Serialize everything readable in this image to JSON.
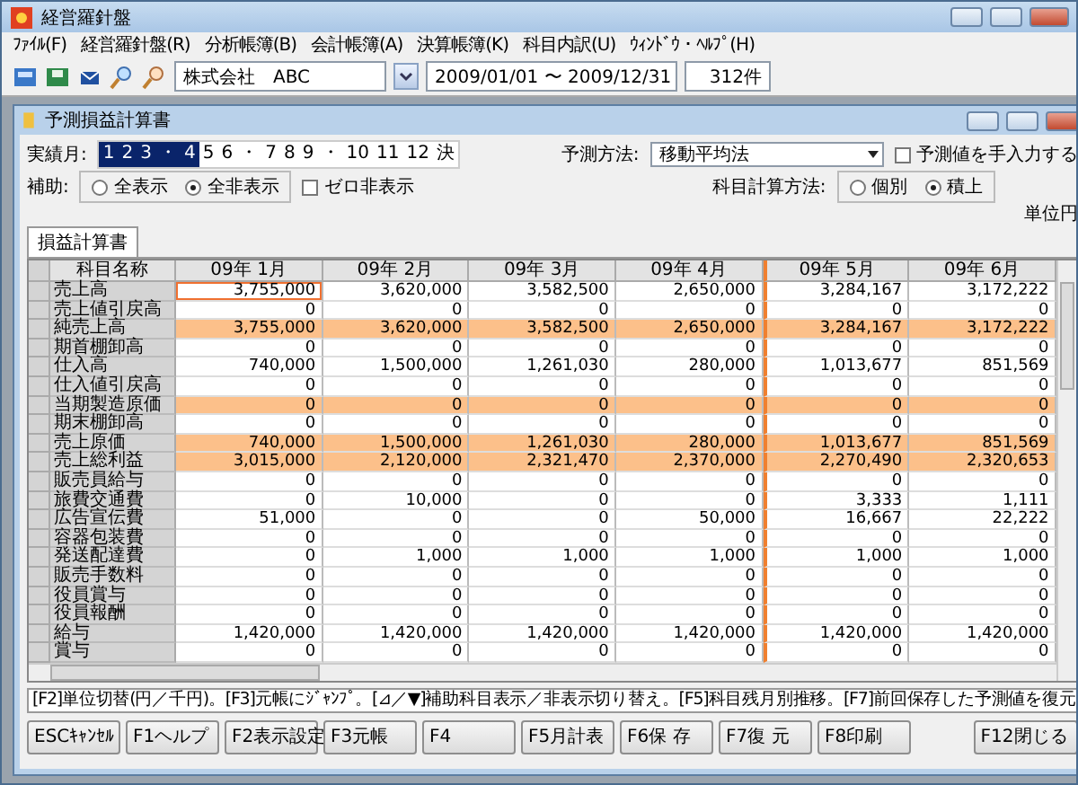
{
  "window": {
    "title": "経営羅針盤"
  },
  "menu": [
    "ﾌｧｲﾙ(F)",
    "経営羅針盤(R)",
    "分析帳簿(B)",
    "会計帳簿(A)",
    "決算帳簿(K)",
    "科目内訳(U)",
    "ｳｨﾝﾄﾞｳ・ﾍﾙﾌﾟ(H)"
  ],
  "toolbar": {
    "company": "株式会社　ABC",
    "period": "2009/01/01 〜 2009/12/31",
    "count": "312件"
  },
  "child_window": {
    "title": "予測損益計算書"
  },
  "actual_months": {
    "label": "実績月:",
    "items": [
      {
        "text": "1",
        "selected": true
      },
      {
        "text": "2",
        "selected": true
      },
      {
        "text": "3",
        "selected": true
      },
      {
        "text": "・",
        "selected": true
      },
      {
        "text": "4",
        "selected": true
      },
      {
        "text": "5",
        "selected": false
      },
      {
        "text": "6",
        "selected": false
      },
      {
        "text": "・",
        "selected": false
      },
      {
        "text": "7",
        "selected": false
      },
      {
        "text": "8",
        "selected": false
      },
      {
        "text": "9",
        "selected": false
      },
      {
        "text": "・",
        "selected": false
      },
      {
        "text": "10",
        "selected": false
      },
      {
        "text": "11",
        "selected": false
      },
      {
        "text": "12",
        "selected": false
      },
      {
        "text": "決",
        "selected": false
      }
    ]
  },
  "aux": {
    "label": "補助:",
    "options": [
      {
        "label": "全表示",
        "selected": false
      },
      {
        "label": "全非表示",
        "selected": true
      }
    ],
    "zero_hide": {
      "label": "ゼロ非表示",
      "checked": false
    }
  },
  "forecast": {
    "label": "予測方法:",
    "method": "移動平均法",
    "manual": {
      "label": "予測値を手入力する",
      "checked": false
    }
  },
  "calc": {
    "label": "科目計算方法:",
    "options": [
      {
        "label": "個別",
        "selected": false
      },
      {
        "label": "積上",
        "selected": true
      }
    ]
  },
  "unit": "単位円",
  "tabs": [
    {
      "label": "損益計算書",
      "selected": true
    }
  ],
  "table": {
    "columns": [
      {
        "label": "科目名称"
      },
      {
        "label": "09年 1月",
        "actual": true
      },
      {
        "label": "09年 2月",
        "actual": true
      },
      {
        "label": "09年 3月",
        "actual": true
      },
      {
        "label": "09年 4月",
        "actual": true
      },
      {
        "label": "09年 5月",
        "actual": false
      },
      {
        "label": "09年 6月",
        "actual": false
      }
    ],
    "rows": [
      {
        "name": "売上高",
        "highlight": false,
        "focused": true,
        "values": [
          "3,755,000",
          "3,620,000",
          "3,582,500",
          "2,650,000",
          "3,284,167",
          "3,172,222"
        ]
      },
      {
        "name": "売上値引戻高",
        "highlight": false,
        "values": [
          "0",
          "0",
          "0",
          "0",
          "0",
          "0"
        ]
      },
      {
        "name": "純売上高",
        "highlight": true,
        "values": [
          "3,755,000",
          "3,620,000",
          "3,582,500",
          "2,650,000",
          "3,284,167",
          "3,172,222"
        ]
      },
      {
        "name": "期首棚卸高",
        "highlight": false,
        "values": [
          "0",
          "0",
          "0",
          "0",
          "0",
          "0"
        ]
      },
      {
        "name": "仕入高",
        "highlight": false,
        "values": [
          "740,000",
          "1,500,000",
          "1,261,030",
          "280,000",
          "1,013,677",
          "851,569"
        ]
      },
      {
        "name": "仕入値引戻高",
        "highlight": false,
        "values": [
          "0",
          "0",
          "0",
          "0",
          "0",
          "0"
        ]
      },
      {
        "name": "当期製造原価",
        "highlight": true,
        "values": [
          "0",
          "0",
          "0",
          "0",
          "0",
          "0"
        ]
      },
      {
        "name": "期末棚卸高",
        "highlight": false,
        "values": [
          "0",
          "0",
          "0",
          "0",
          "0",
          "0"
        ]
      },
      {
        "name": "売上原価",
        "highlight": true,
        "values": [
          "740,000",
          "1,500,000",
          "1,261,030",
          "280,000",
          "1,013,677",
          "851,569"
        ]
      },
      {
        "name": "売上総利益",
        "highlight": true,
        "values": [
          "3,015,000",
          "2,120,000",
          "2,321,470",
          "2,370,000",
          "2,270,490",
          "2,320,653"
        ]
      },
      {
        "name": "販売員給与",
        "highlight": false,
        "values": [
          "0",
          "0",
          "0",
          "0",
          "0",
          "0"
        ]
      },
      {
        "name": "旅費交通費",
        "highlight": false,
        "values": [
          "0",
          "10,000",
          "0",
          "0",
          "3,333",
          "1,111"
        ]
      },
      {
        "name": "広告宣伝費",
        "highlight": false,
        "values": [
          "51,000",
          "0",
          "0",
          "50,000",
          "16,667",
          "22,222"
        ]
      },
      {
        "name": "容器包装費",
        "highlight": false,
        "values": [
          "0",
          "0",
          "0",
          "0",
          "0",
          "0"
        ]
      },
      {
        "name": "発送配達費",
        "highlight": false,
        "values": [
          "0",
          "1,000",
          "1,000",
          "1,000",
          "1,000",
          "1,000"
        ]
      },
      {
        "name": "販売手数料",
        "highlight": false,
        "values": [
          "0",
          "0",
          "0",
          "0",
          "0",
          "0"
        ]
      },
      {
        "name": "役員賞与",
        "highlight": false,
        "values": [
          "0",
          "0",
          "0",
          "0",
          "0",
          "0"
        ]
      },
      {
        "name": "役員報酬",
        "highlight": false,
        "values": [
          "0",
          "0",
          "0",
          "0",
          "0",
          "0"
        ]
      },
      {
        "name": "給与",
        "highlight": false,
        "values": [
          "1,420,000",
          "1,420,000",
          "1,420,000",
          "1,420,000",
          "1,420,000",
          "1,420,000"
        ]
      },
      {
        "name": "賞与",
        "highlight": false,
        "values": [
          "0",
          "0",
          "0",
          "0",
          "0",
          "0"
        ]
      }
    ]
  },
  "status": "[F2]単位切替(円／千円)。[F3]元帳にｼﾞｬﾝﾌﾟ。[⊿／▼]補助科目表示／非表示切り替え。[F5]科目残月別推移。[F7]前回保存した予測値を復元",
  "buttons": [
    {
      "label": "ESCｷｬﾝｾﾙ"
    },
    {
      "label": "F1ヘルプ"
    },
    {
      "label": "F2表示設定"
    },
    {
      "label": "F3元帳"
    },
    {
      "label": "F4"
    },
    {
      "label": "F5月計表"
    },
    {
      "label": "F6保 存"
    },
    {
      "label": "F7復 元"
    },
    {
      "label": "F8印刷"
    },
    {
      "label": "F12閉じる",
      "apart": true
    }
  ]
}
